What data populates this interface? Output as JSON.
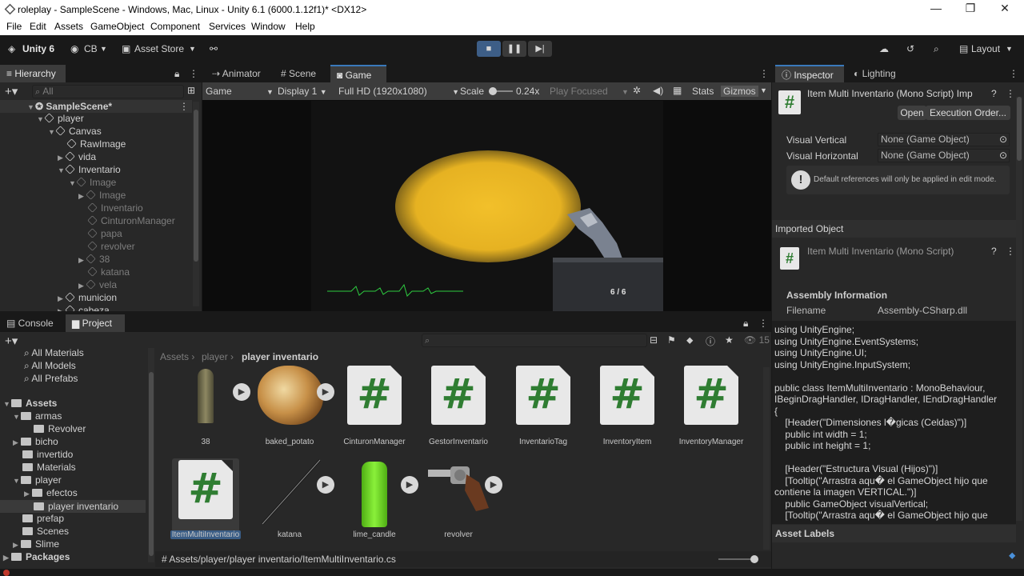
{
  "window": {
    "title": "roleplay - SampleScene - Windows, Mac, Linux - Unity 6.1 (6000.1.12f1)* <DX12>",
    "minimize": "—",
    "maximize": "❐",
    "close": "✕"
  },
  "menu": [
    "File",
    "Edit",
    "Assets",
    "GameObject",
    "Component",
    "Services",
    "Window",
    "Help"
  ],
  "toolbar": {
    "unity": "Unity 6",
    "account": "CB",
    "asset_store": "Asset Store",
    "layout": "Layout"
  },
  "hierarchy": {
    "tab": "Hierarchy",
    "search_placeholder": "All",
    "scene": "SampleScene*",
    "items": [
      "player",
      "Canvas",
      "RawImage",
      "vida",
      "Inventario",
      "Image",
      "Image",
      "Inventario",
      "CinturonManager",
      "papa",
      "revolver",
      "38",
      "katana",
      "vela",
      "municion",
      "cabeza"
    ]
  },
  "center_tabs": {
    "animator": "Animator",
    "scene": "Scene",
    "game": "Game"
  },
  "game_bar": {
    "mode": "Game",
    "display": "Display 1",
    "resolution": "Full HD (1920x1080)",
    "scale_label": "Scale",
    "scale_value": "0.24x",
    "play_focused": "Play Focused",
    "stats": "Stats",
    "gizmos": "Gizmos"
  },
  "game_view": {
    "ammo": "6 / 6"
  },
  "inspector": {
    "tab": "Inspector",
    "lighting_tab": "Lighting",
    "script_title": "Item Multi Inventario (Mono Script) Imp",
    "open": "Open",
    "execution_order": "Execution Order...",
    "fields": [
      {
        "label": "Visual Vertical",
        "value": "None (Game Object)"
      },
      {
        "label": "Visual Horizontal",
        "value": "None (Game Object)"
      }
    ],
    "info": "Default references will only be applied in edit mode.",
    "imported_object": "Imported Object",
    "imported_title": "Item Multi Inventario (Mono Script)",
    "assembly_header": "Assembly Information",
    "filename_label": "Filename",
    "filename_value": "Assembly-CSharp.dll",
    "code_lines": [
      "using UnityEngine;",
      "using UnityEngine.EventSystems;",
      "using UnityEngine.UI;",
      "using UnityEngine.InputSystem;",
      "",
      "public class ItemMultiInventario : MonoBehaviour,",
      "IBeginDragHandler, IDragHandler, IEndDragHandler",
      "{",
      "    [Header(\"Dimensiones l�gicas (Celdas)\")]",
      "    public int width = 1;",
      "    public int height = 1;",
      "",
      "    [Header(\"Estructura Visual (Hijos)\")]",
      "    [Tooltip(\"Arrastra aqu� el GameObject hijo que",
      "contiene la imagen VERTICAL.\")]",
      "    public GameObject visualVertical;",
      "    [Tooltip(\"Arrastra aqu� el GameObject hijo que"
    ],
    "asset_labels": "Asset Labels"
  },
  "bottom_tabs": {
    "console": "Console",
    "project": "Project"
  },
  "project": {
    "count": "15",
    "favorites": [
      "All Materials",
      "All Models",
      "All Prefabs"
    ],
    "tree": [
      {
        "label": "Assets",
        "level": 0
      },
      {
        "label": "armas",
        "level": 1
      },
      {
        "label": "Revolver",
        "level": 2
      },
      {
        "label": "bicho",
        "level": 1
      },
      {
        "label": "invertido",
        "level": 1
      },
      {
        "label": "Materials",
        "level": 1
      },
      {
        "label": "player",
        "level": 1
      },
      {
        "label": "efectos",
        "level": 2
      },
      {
        "label": "player inventario",
        "level": 2
      },
      {
        "label": "prefap",
        "level": 1
      },
      {
        "label": "Scenes",
        "level": 1
      },
      {
        "label": "Slime",
        "level": 1
      },
      {
        "label": "Packages",
        "level": 0
      }
    ],
    "breadcrumb": [
      "Assets",
      "player",
      "player inventario"
    ],
    "assets": [
      "38",
      "baked_potato",
      "CinturonManager",
      "GestorInventario",
      "InventarioTag",
      "InventoryItem",
      "InventoryManager",
      "ItemMultiInventario",
      "katana",
      "lime_candle",
      "revolver"
    ],
    "path": "Assets/player/player inventario/ItemMultiInventario.cs"
  }
}
